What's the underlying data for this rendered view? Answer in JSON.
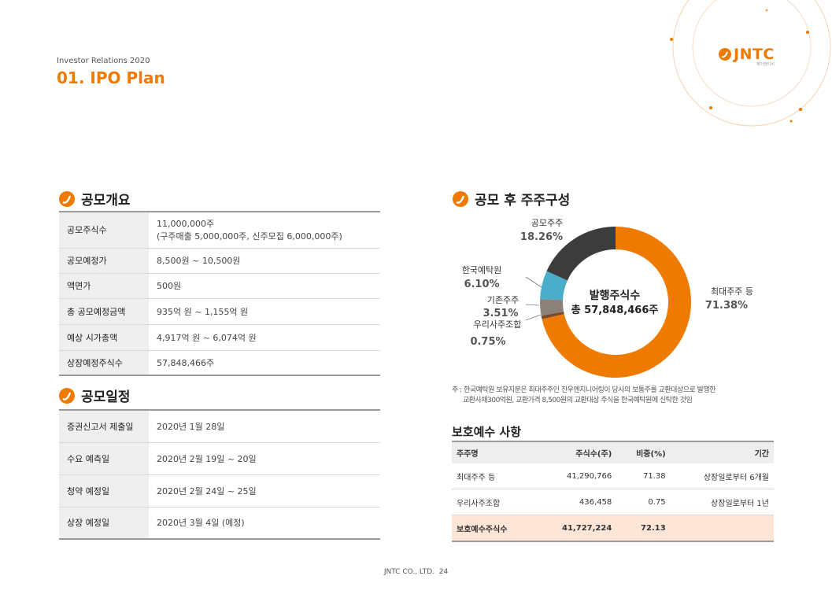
{
  "header": {
    "supertitle": "Investor Relations 2020",
    "title": "01. IPO Plan"
  },
  "logo": {
    "brand": "JNTC",
    "sub": "제이엔티씨"
  },
  "colors": {
    "accent": "#ee7a00",
    "dark": "#3c3c3c",
    "teal": "#4aaecb",
    "grey": "#8a8278",
    "brown": "#7a4a2a"
  },
  "overview": {
    "heading": "공모개요",
    "rows": [
      {
        "label": "공모주식수",
        "value": "11,000,000주",
        "value2": "(구주매출 5,000,000주, 신주모집 6,000,000주)"
      },
      {
        "label": "공모예정가",
        "value": "8,500원 ~ 10,500원"
      },
      {
        "label": "액면가",
        "value": "500원"
      },
      {
        "label": "총 공모예정금액",
        "value": "935억 원 ~ 1,155억 원"
      },
      {
        "label": "예상 시가총액",
        "value": "4,917억 원 ~ 6,074억 원"
      },
      {
        "label": "상장예정주식수",
        "value": "57,848,466주"
      }
    ]
  },
  "schedule": {
    "heading": "공모일정",
    "rows": [
      {
        "label": "증권신고서 제출일",
        "value": "2020년 1월 28일"
      },
      {
        "label": "수요 예측일",
        "value": "2020년 2월 19일 ~ 20일"
      },
      {
        "label": "청약 예정일",
        "value": "2020년 2월 24일 ~ 25일"
      },
      {
        "label": "상장 예정일",
        "value": "2020년 3월 4일 (예정)"
      }
    ]
  },
  "shareholders": {
    "heading": "공모 후 주주구성",
    "center_line1": "발행주식수",
    "center_line2": "총 57,848,466주",
    "note_line1": "주 : 한국예탁원 보유지분은 최대주주인 진우엔지니어링이 당사의 보통주를 교환대상으로 발행한",
    "note_line2": "교환사채300억원, 교환가격 8,500원의 교환대상 주식을 한국예탁원에 신탁한 것임"
  },
  "chart_data": {
    "type": "pie",
    "donut": true,
    "categories": [
      "최대주주 등",
      "우리사주조합",
      "기존주주",
      "한국예탁원",
      "공모주주"
    ],
    "values": [
      71.38,
      0.75,
      3.51,
      6.1,
      18.26
    ],
    "value_labels": [
      "71.38%",
      "0.75%",
      "3.51%",
      "6.10%",
      "18.26%"
    ],
    "colors": [
      "#ee7a00",
      "#7a4a2a",
      "#8a8278",
      "#4aaecb",
      "#3c3c3c"
    ]
  },
  "lockup": {
    "heading": "보호예수 사항",
    "columns": [
      "주주명",
      "주식수(주)",
      "비중(%)",
      "기간"
    ],
    "rows": [
      [
        "최대주주 등",
        "41,290,766",
        "71.38",
        "상장일로부터 6개월"
      ],
      [
        "우리사주조합",
        "436,458",
        "0.75",
        "상장일로부터 1년"
      ]
    ],
    "total": [
      "보호예수주식수",
      "41,727,224",
      "72.13",
      ""
    ]
  },
  "footer": {
    "company": "JNTC CO., LTD.",
    "page": "24"
  }
}
